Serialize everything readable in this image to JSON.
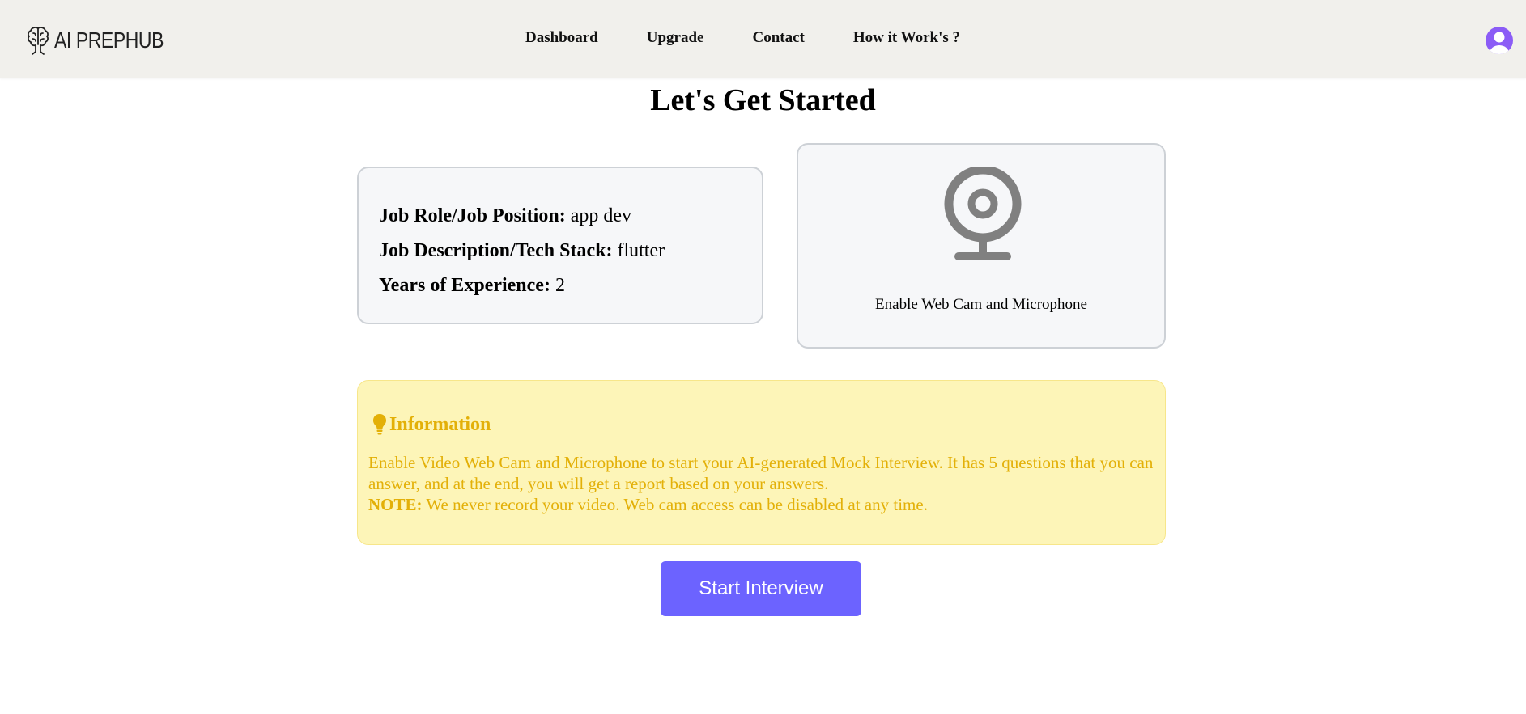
{
  "header": {
    "brand": "AI PREPHUB",
    "nav": [
      {
        "label": "Dashboard"
      },
      {
        "label": "Upgrade"
      },
      {
        "label": "Contact"
      },
      {
        "label": "How it Work's ?"
      }
    ],
    "avatar_icon": "user-avatar-icon",
    "avatar_color": "#8b5cf6"
  },
  "main": {
    "title": "Let's Get Started",
    "job_info": {
      "role_label": "Job Role/Job Position:",
      "role_value": "app dev",
      "desc_label": "Job Description/Tech Stack:",
      "desc_value": "flutter",
      "exp_label": "Years of Experience:",
      "exp_value": "2"
    },
    "webcam": {
      "icon": "webcam-icon",
      "label": "Enable Web Cam and Microphone"
    },
    "info": {
      "icon": "lightbulb-icon",
      "title": "Information",
      "text": "Enable Video Web Cam and Microphone to start your AI-generated Mock Interview. It has 5 questions that you can answer, and at the end, you will get a report based on your answers.",
      "note_label": "NOTE:",
      "note_text": " We never record your video. Web cam access can be disabled at any time."
    },
    "start_button": "Start Interview"
  },
  "colors": {
    "navbar_bg": "#f1f0ec",
    "info_bg": "#fdf5b8",
    "info_text": "#e3b008",
    "primary_button": "#6c63ff",
    "webcam_icon": "#808080"
  }
}
